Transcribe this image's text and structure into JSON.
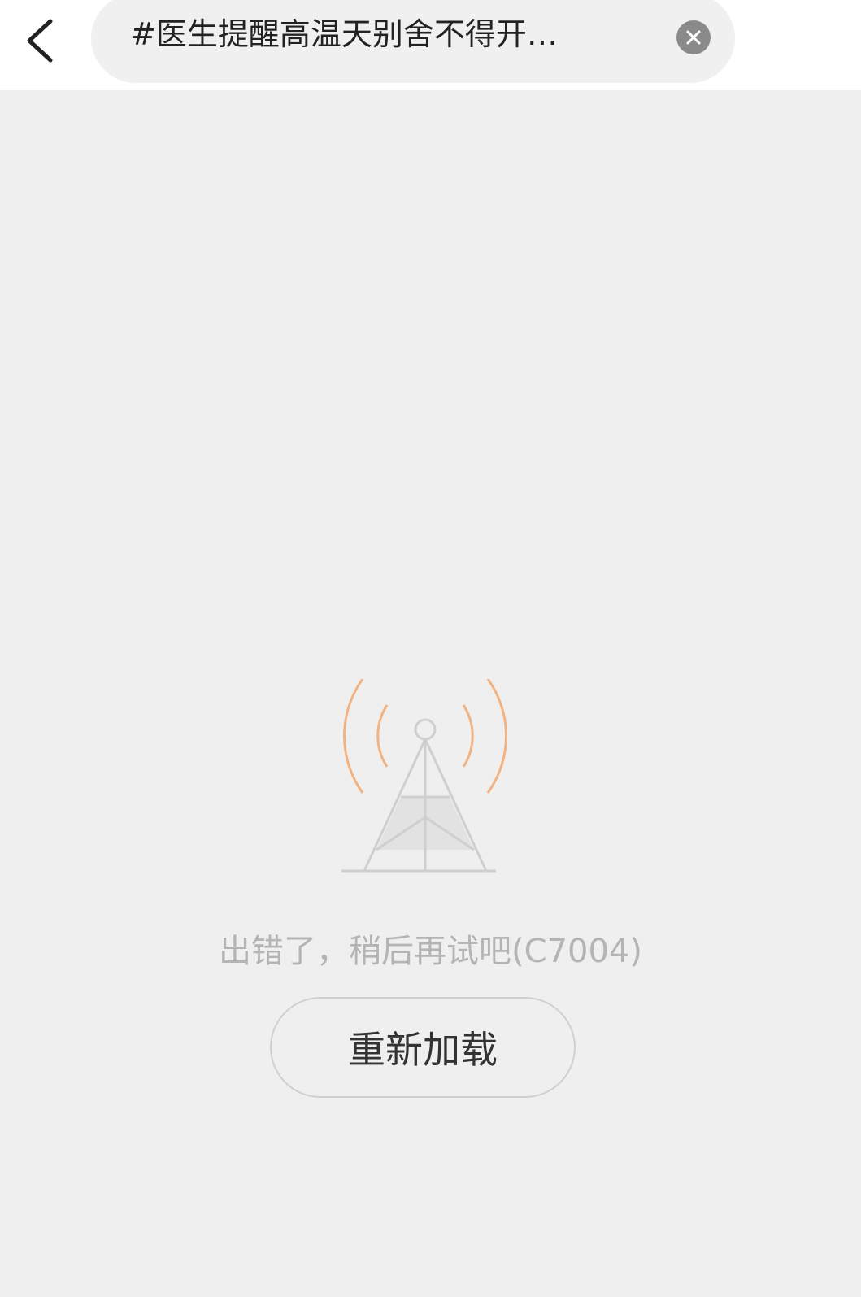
{
  "header": {
    "back_icon": "chevron-left-icon",
    "search": {
      "query": "#医生提醒高温天别舍不得开…",
      "clear_icon": "close-icon"
    }
  },
  "error_state": {
    "illustration_icon": "signal-tower-icon",
    "message": "出错了，稍后再试吧(C7004)",
    "reload_label": "重新加载"
  },
  "colors": {
    "background": "#efefef",
    "header_background": "#ffffff",
    "search_background": "#f0f0f0",
    "signal_wave": "#f2b383",
    "tower": "#cfcfcf",
    "error_text": "#b4b4b4"
  }
}
